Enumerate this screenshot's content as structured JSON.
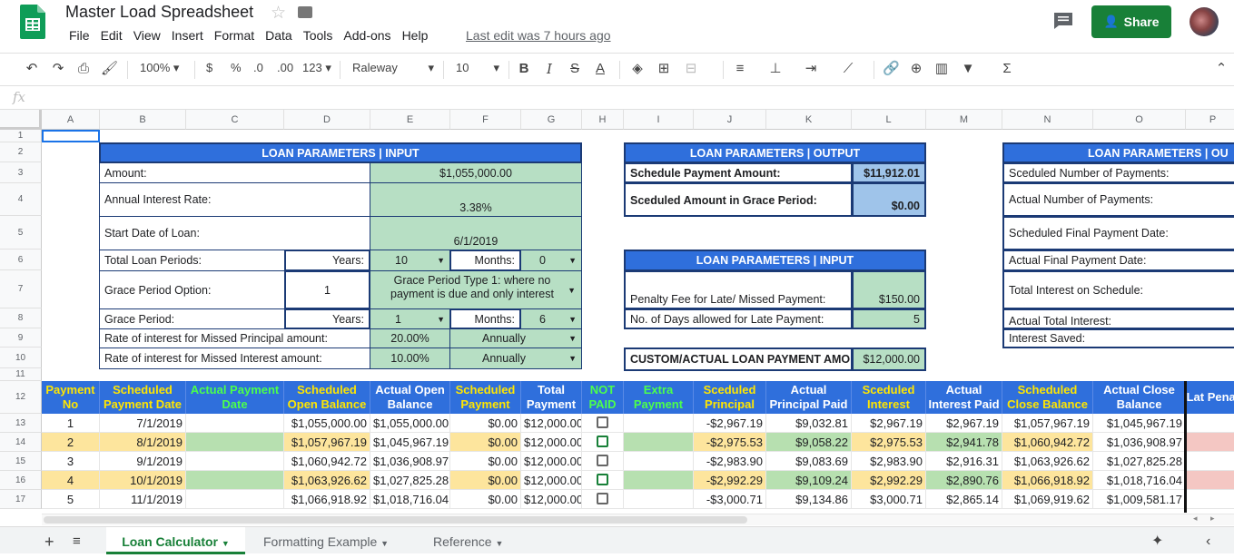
{
  "app": {
    "title": "Master Load Spreadsheet",
    "menu": [
      "File",
      "Edit",
      "View",
      "Insert",
      "Format",
      "Data",
      "Tools",
      "Add-ons",
      "Help"
    ],
    "last_edit": "Last edit was 7 hours ago",
    "share_label": "Share"
  },
  "toolbar": {
    "zoom": "100%",
    "currency": "$",
    "percent": "%",
    "dec_less": ".0",
    "dec_more": ".00",
    "more_formats": "123",
    "font": "Raleway",
    "font_size": "10"
  },
  "formula_bar": {
    "fx": "fx",
    "value": ""
  },
  "columns": [
    "A",
    "B",
    "C",
    "D",
    "E",
    "F",
    "G",
    "H",
    "I",
    "J",
    "K",
    "L",
    "M",
    "N",
    "O",
    "P"
  ],
  "rows": [
    "1",
    "2",
    "3",
    "4",
    "5",
    "6",
    "7",
    "8",
    "9",
    "10",
    "11",
    "12",
    "13",
    "14",
    "15",
    "16",
    "17"
  ],
  "input": {
    "header": "LOAN PARAMETERS | INPUT",
    "amount_label": "Amount:",
    "amount": "$1,055,000.00",
    "rate_label": "Annual Interest Rate:",
    "rate": "3.38%",
    "start_label": "Start Date of Loan:",
    "start": "6/1/2019",
    "periods_label": "Total Loan Periods:",
    "years_label": "Years:",
    "years": "10",
    "months_label": "Months:",
    "months": "0",
    "grace_opt_label": "Grace Period Option:",
    "grace_opt": "1",
    "grace_type": "Grace Period Type 1: where no payment is due and only interest",
    "grace_label": "Grace Period:",
    "grace_years_label": "Years:",
    "grace_years": "1",
    "grace_months_label": "Months:",
    "grace_months": "6",
    "missed_principal_label": "Rate of interest for Missed Principal amount:",
    "missed_principal_rate": "20.00%",
    "missed_principal_freq": "Annually",
    "missed_interest_label": "Rate of interest for Missed Interest amount:",
    "missed_interest_rate": "10.00%",
    "missed_interest_freq": "Annually"
  },
  "output": {
    "header": "LOAN PARAMETERS | OUTPUT",
    "sched_label": "Schedule Payment Amount:",
    "sched": "$11,912.01",
    "grace_amt_label": "Sceduled Amount in Grace Period:",
    "grace_amt": "$0.00"
  },
  "input2": {
    "header": "LOAN PARAMETERS | INPUT",
    "penalty_label": "Penalty Fee for Late/ Missed Payment:",
    "penalty": "$150.00",
    "days_label": "No. of Days allowed for Late Payment:",
    "days": "5",
    "custom_label": "CUSTOM/ACTUAL LOAN PAYMENT AMO",
    "custom": "$12,000.00"
  },
  "output2": {
    "header": "LOAN PARAMETERS | OU",
    "labels": [
      "Sceduled Number of Payments:",
      "Actual Number of Payments:",
      "Scheduled Final Payment Date:",
      "Actual Final Payment Date:",
      "Total Interest on Schedule:",
      "Actual Total Interest:",
      "Interest Saved:"
    ]
  },
  "table": {
    "headers": [
      {
        "t": "Payment No",
        "c": "y"
      },
      {
        "t": "Scheduled Payment Date",
        "c": "y"
      },
      {
        "t": "Actual Payment Date",
        "c": "g"
      },
      {
        "t": "Scheduled Open Balance",
        "c": "y"
      },
      {
        "t": "Actual Open Balance",
        "c": "w"
      },
      {
        "t": "Scheduled Payment",
        "c": "y"
      },
      {
        "t": "Total Payment",
        "c": "w"
      },
      {
        "t": "NOT PAID",
        "c": "g"
      },
      {
        "t": "Extra Payment",
        "c": "g"
      },
      {
        "t": "Sceduled Principal",
        "c": "y"
      },
      {
        "t": "Actual Principal Paid",
        "c": "w"
      },
      {
        "t": "Sceduled Interest",
        "c": "y"
      },
      {
        "t": "Actual Interest Paid",
        "c": "w"
      },
      {
        "t": "Scheduled Close Balance",
        "c": "y"
      },
      {
        "t": "Actual Close Balance",
        "c": "w"
      },
      {
        "t": "Lat Penal",
        "c": "w"
      }
    ],
    "rows": [
      [
        "1",
        "7/1/2019",
        "",
        "$1,055,000.00",
        "$1,055,000.00",
        "$0.00",
        "$12,000.00",
        "",
        "",
        "-$2,967.19",
        "$9,032.81",
        "$2,967.19",
        "$2,967.19",
        "$1,057,967.19",
        "$1,045,967.19",
        ""
      ],
      [
        "2",
        "8/1/2019",
        "",
        "$1,057,967.19",
        "$1,045,967.19",
        "$0.00",
        "$12,000.00",
        "",
        "",
        "-$2,975.53",
        "$9,058.22",
        "$2,975.53",
        "$2,941.78",
        "$1,060,942.72",
        "$1,036,908.97",
        ""
      ],
      [
        "3",
        "9/1/2019",
        "",
        "$1,060,942.72",
        "$1,036,908.97",
        "$0.00",
        "$12,000.00",
        "",
        "",
        "-$2,983.90",
        "$9,083.69",
        "$2,983.90",
        "$2,916.31",
        "$1,063,926.62",
        "$1,027,825.28",
        ""
      ],
      [
        "4",
        "10/1/2019",
        "",
        "$1,063,926.62",
        "$1,027,825.28",
        "$0.00",
        "$12,000.00",
        "",
        "",
        "-$2,992.29",
        "$9,109.24",
        "$2,992.29",
        "$2,890.76",
        "$1,066,918.92",
        "$1,018,716.04",
        ""
      ],
      [
        "5",
        "11/1/2019",
        "",
        "$1,066,918.92",
        "$1,018,716.04",
        "$0.00",
        "$12,000.00",
        "",
        "",
        "-$3,000.71",
        "$9,134.86",
        "$3,000.71",
        "$2,865.14",
        "$1,069,919.62",
        "$1,009,581.17",
        ""
      ]
    ]
  },
  "sheets": [
    "Loan Calculator",
    "Formatting Example",
    "Reference"
  ],
  "colors": {
    "header_blue": "#2f6fdc",
    "input_green": "#b7dfc4",
    "output_blue": "#9fc4ea",
    "row_yellow": "#fde59d",
    "row_green": "#b7e0b0",
    "share_green": "#188038"
  }
}
